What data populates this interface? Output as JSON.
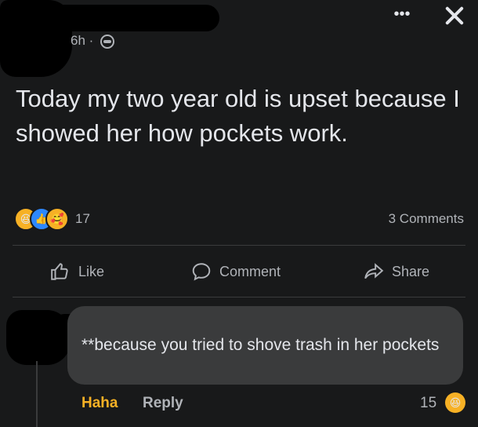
{
  "post": {
    "time": "6h ·",
    "text": "Today my two year old is upset because I showed her how pockets work.",
    "reaction_count": "17",
    "comments_count": "3 Comments"
  },
  "actions": {
    "like": "Like",
    "comment": "Comment",
    "share": "Share"
  },
  "comment": {
    "text": "**because you tried to shove trash in her pockets",
    "haha_label": "Haha",
    "reply_label": "Reply",
    "reaction_count": "15"
  },
  "icons": {
    "more": "more-dots-icon",
    "close": "close-icon",
    "privacy": "globe-icon",
    "reactions": [
      "haha-reaction-icon",
      "like-reaction-icon",
      "care-reaction-icon"
    ]
  },
  "colors": {
    "background": "#18191a",
    "bubble": "#3a3b3c",
    "text": "#e4e6eb",
    "secondary": "#b0b3b8",
    "haha": "#f7b125",
    "like": "#2d88ff"
  }
}
